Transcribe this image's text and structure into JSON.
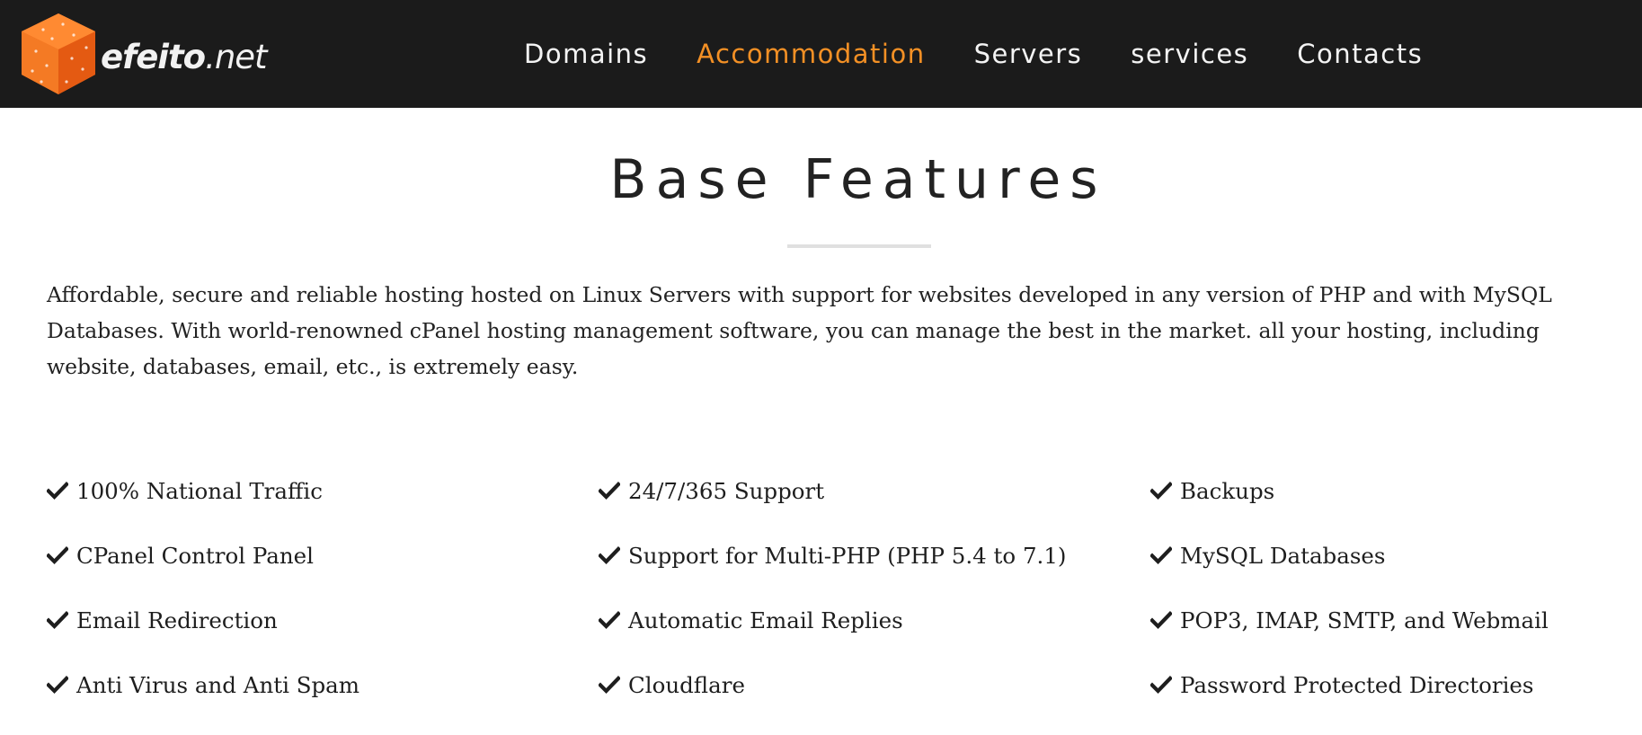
{
  "header": {
    "logo": {
      "text_strong": "efeito",
      "text_light": ".net",
      "icon": "orange-cube-logo-icon"
    },
    "nav": [
      {
        "label": "Domains",
        "active": false
      },
      {
        "label": "Accommodation",
        "active": true
      },
      {
        "label": "Servers",
        "active": false
      },
      {
        "label": "services",
        "active": false
      },
      {
        "label": "Contacts",
        "active": false
      }
    ]
  },
  "main": {
    "title": "Base Features",
    "intro": "Affordable, secure and reliable hosting hosted on Linux Servers with support for websites developed in any version of PHP and with MySQL Databases. With world-renowned cPanel hosting management software, you can manage the best in the market. all your hosting, including website, databases, email, etc., is extremely easy.",
    "features": [
      "100% National Traffic",
      "24/7/365 Support",
      "Backups",
      "CPanel Control Panel",
      "Support for Multi-PHP (PHP 5.4 to 7.1)",
      "MySQL Databases",
      "Email Redirection",
      "Automatic Email Replies",
      "POP3, IMAP, SMTP, and Webmail",
      "Anti Virus and Anti Spam",
      "Cloudflare",
      "Password Protected Directories"
    ],
    "feature_icon": "check-icon"
  },
  "colors": {
    "header_bg": "#1b1b1b",
    "nav_text": "#f4f4f4",
    "nav_active": "#f39025",
    "logo_orange": "#f26a1b",
    "divider": "#e0e0e0",
    "body_text": "#222222"
  }
}
